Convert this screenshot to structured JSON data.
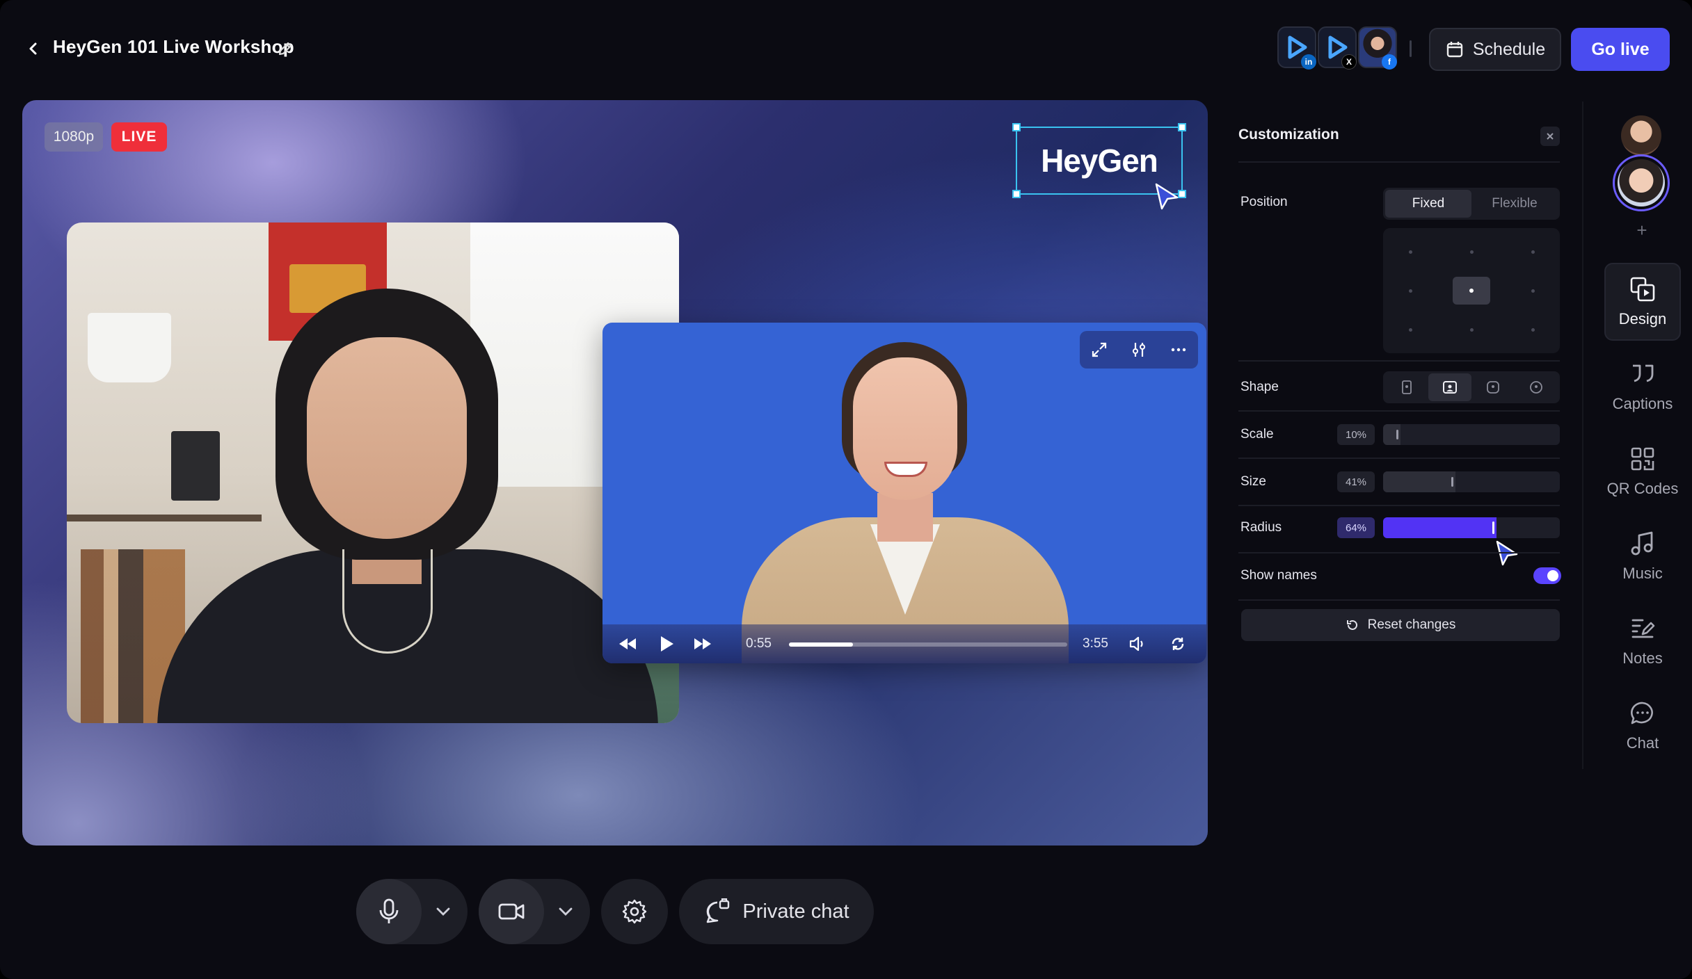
{
  "header": {
    "title": "HeyGen 101 Live Workshop",
    "schedule_label": "Schedule",
    "go_live_label": "Go live",
    "platforms": [
      {
        "name": "LinkedIn",
        "badge": "in",
        "badge_color": "#0a66c2"
      },
      {
        "name": "X",
        "badge": "X",
        "badge_color": "#000000"
      },
      {
        "name": "Facebook",
        "badge": "f",
        "badge_color": "#1877f2"
      }
    ]
  },
  "stage": {
    "resolution": "1080p",
    "live": "LIVE",
    "logo_text": "HeyGen",
    "player": {
      "current_time": "0:55",
      "duration": "3:55",
      "progress": 0.23
    }
  },
  "controls": {
    "private_chat": "Private chat"
  },
  "panel": {
    "title": "Customization",
    "position": {
      "label": "Position",
      "options": [
        "Fixed",
        "Flexible"
      ],
      "selected": "Fixed",
      "selected_cell": "center"
    },
    "shape": {
      "label": "Shape",
      "selected_index": 1
    },
    "scale": {
      "label": "Scale",
      "value": "10%",
      "fraction": 0.1
    },
    "size": {
      "label": "Size",
      "value": "41%",
      "fraction": 0.41
    },
    "radius": {
      "label": "Radius",
      "value": "64%",
      "fraction": 0.64
    },
    "show_names": {
      "label": "Show names",
      "on": true
    },
    "reset_label": "Reset changes"
  },
  "rail": {
    "items": [
      {
        "label": "Design",
        "icon": "design-icon",
        "active": true
      },
      {
        "label": "Captions",
        "icon": "captions-icon"
      },
      {
        "label": "QR Codes",
        "icon": "qr-code-icon"
      },
      {
        "label": "Music",
        "icon": "music-icon"
      },
      {
        "label": "Notes",
        "icon": "notes-icon"
      },
      {
        "label": "Chat",
        "icon": "chat-icon"
      }
    ]
  },
  "colors": {
    "accent": "#4a4cf0",
    "live": "#ef2f3a",
    "slider_active": "#5233f4",
    "selection": "#3ac3f0"
  }
}
